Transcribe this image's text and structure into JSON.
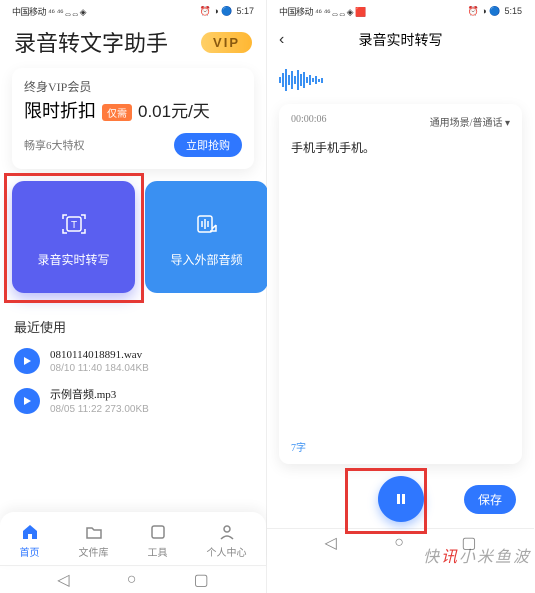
{
  "left": {
    "status": {
      "carrier": "中国移动 ⁴⁶ ⁴⁶ ꜀꜆ ꜀꜆ ◈",
      "icons": "⏰ ◑ 🔵",
      "time": "5:17"
    },
    "app_title": "录音转文字助手",
    "vip_badge": "VIP",
    "promo": {
      "line1": "终身VIP会员",
      "line2_big": "限时折扣",
      "tag": "仅需",
      "price": "0.01元/天",
      "features": "畅享6大特权",
      "buy": "立即抢购"
    },
    "cards": [
      {
        "icon": "text-box-icon",
        "label": "录音实时转写"
      },
      {
        "icon": "import-audio-icon",
        "label": "导入外部音频"
      }
    ],
    "recent_title": "最近使用",
    "files": [
      {
        "name": "0810114018891.wav",
        "sub": "08/10 11:40  184.04KB"
      },
      {
        "name": "示例音频.mp3",
        "sub": "08/05 11:22  273.00KB"
      }
    ],
    "tabs": [
      {
        "icon": "home-icon",
        "label": "首页",
        "on": true
      },
      {
        "icon": "folder-icon",
        "label": "文件库",
        "on": false
      },
      {
        "icon": "tools-icon",
        "label": "工具",
        "on": false
      },
      {
        "icon": "user-icon",
        "label": "个人中心",
        "on": false
      }
    ]
  },
  "right": {
    "status": {
      "carrier": "中国移动 ⁴⁶ ⁴⁶ ꜀꜆ ꜀꜆ ◈ 🟥",
      "icons": "⏰ ◑ 🔵",
      "time": "5:15"
    },
    "title": "录音实时转写",
    "timer": "00:00:06",
    "scene": "通用场景/普通话 ▾",
    "body": "手机手机手机。",
    "count": "7字",
    "save": "保存"
  },
  "watermark_plain": "快",
  "watermark_red": "讯",
  "watermark_tail": "小米鱼波"
}
